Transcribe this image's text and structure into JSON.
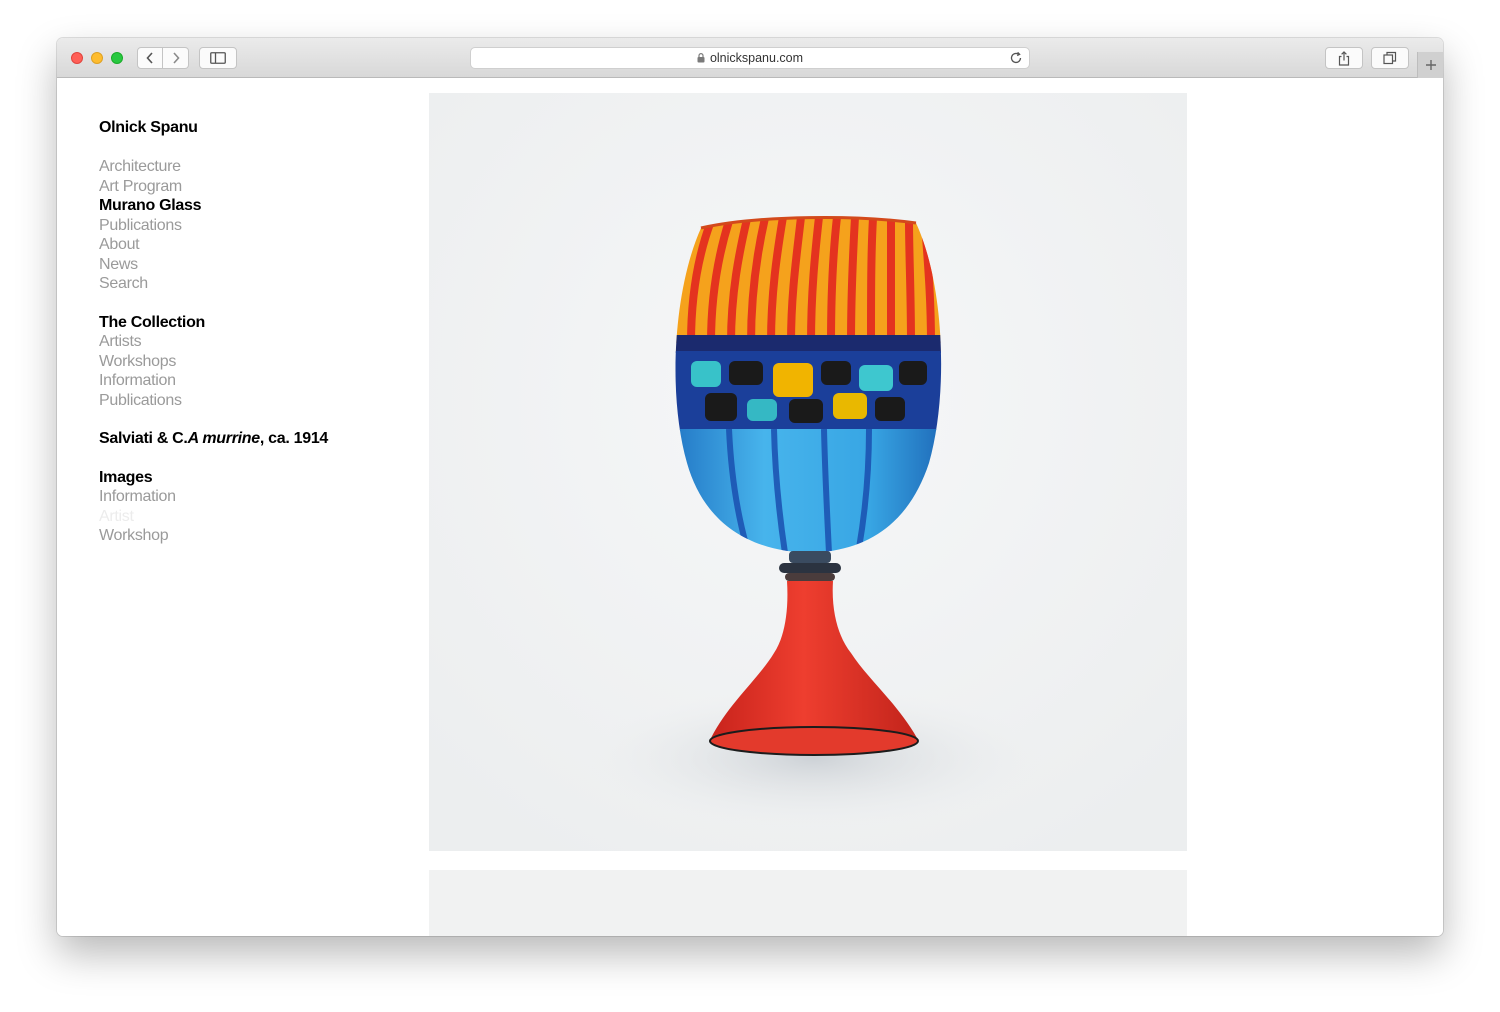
{
  "browser": {
    "url": "olnickspanu.com"
  },
  "nav": {
    "site_title": "Olnick Spanu",
    "main_items": [
      {
        "label": "Architecture"
      },
      {
        "label": "Art Program"
      },
      {
        "label": "Murano Glass"
      },
      {
        "label": "Publications"
      },
      {
        "label": "About"
      },
      {
        "label": "News"
      },
      {
        "label": "Search"
      }
    ],
    "collection": {
      "heading": "The Collection",
      "items": [
        {
          "label": "Artists"
        },
        {
          "label": "Workshops"
        },
        {
          "label": "Information"
        },
        {
          "label": "Publications"
        }
      ]
    },
    "object": {
      "maker": "Salviati & C.",
      "title": "A murrine",
      "date": ", ca. 1914"
    },
    "images_section": {
      "heading": "Images",
      "items": [
        {
          "label": "Information"
        },
        {
          "label": "Artist"
        },
        {
          "label": "Workshop"
        }
      ]
    }
  },
  "colors": {
    "nav_inactive": "#9a9a9a",
    "nav_active": "#000000",
    "image_background": "#f3f4f5",
    "glass_red": "#e8382a",
    "glass_orange": "#f5a21c",
    "glass_blue": "#2f8fd4",
    "glass_dark_blue": "#1b3f9a"
  },
  "icons": [
    "back-icon",
    "forward-icon",
    "sidebar-icon",
    "lock-icon",
    "reload-icon",
    "share-icon",
    "tabs-icon",
    "plus-icon"
  ]
}
